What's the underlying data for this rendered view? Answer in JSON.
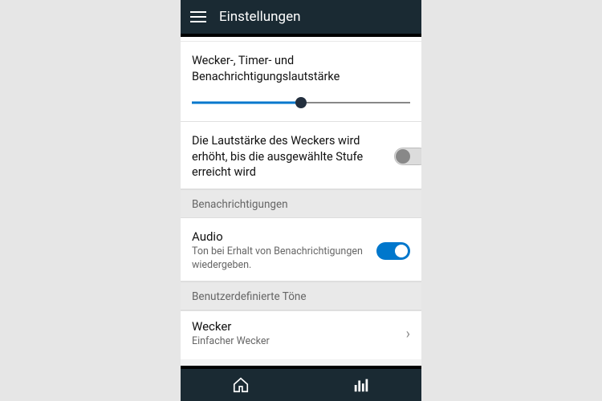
{
  "header": {
    "title": "Einstellungen"
  },
  "volume": {
    "label": "Wecker-, Timer- und Benachrichtigungslautstärke",
    "value_percent": 50
  },
  "ascending": {
    "label": "Die Lautstärke des Weckers wird erhöht, bis die ausgewählte Stufe erreicht wird",
    "enabled": false
  },
  "sections": {
    "notifications_header": "Benachrichtigungen",
    "audio": {
      "title": "Audio",
      "subtitle": "Ton bei Erhalt von Benachrichtigungen wiedergeben.",
      "enabled": true
    },
    "custom_sounds_header": "Benutzerdefinierte Töne",
    "alarm": {
      "title": "Wecker",
      "subtitle": "Einfacher Wecker"
    }
  }
}
